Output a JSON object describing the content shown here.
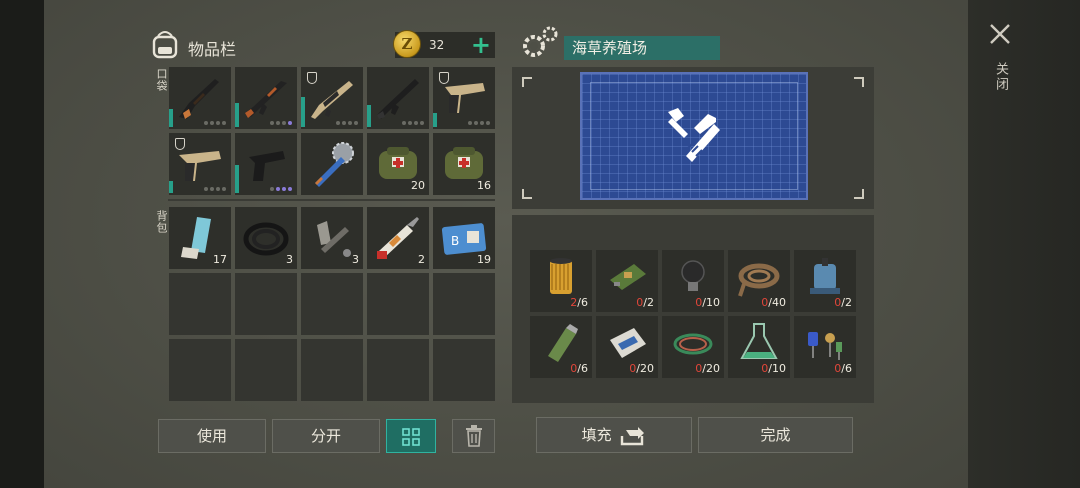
{
  "inventory": {
    "title": "物品栏",
    "coins": "32",
    "coin_symbol": "Z",
    "plus": "+",
    "pocket_label": "口袋",
    "backpack_label": "背包",
    "pocket_slots": [
      {
        "item": "sniper-rifle-icon",
        "count": "",
        "dots": 4
      },
      {
        "item": "assault-rifle-ak-icon",
        "count": "",
        "dots": 4
      },
      {
        "item": "tan-rifle-icon",
        "count": "",
        "dots": 4
      },
      {
        "item": "m4-rifle-icon",
        "count": "",
        "dots": 4
      },
      {
        "item": "tan-pistol-icon",
        "count": "",
        "dots": 4
      },
      {
        "item": "tan-pistol-icon",
        "count": "",
        "dots": 4
      },
      {
        "item": "black-pistol-icon",
        "count": "",
        "dots": 4
      },
      {
        "item": "saw-bat-icon",
        "count": "",
        "dots": 0
      },
      {
        "item": "medkit-bag-icon",
        "count": "20"
      },
      {
        "item": "medkit-bag-icon",
        "count": "16"
      }
    ],
    "backpack_slots": [
      {
        "item": "inhaler-icon",
        "count": "17"
      },
      {
        "item": "hose-coil-icon",
        "count": "3"
      },
      {
        "item": "pipe-parts-icon",
        "count": "3"
      },
      {
        "item": "syringe-icon",
        "count": "2"
      },
      {
        "item": "id-card-icon",
        "count": "19"
      }
    ]
  },
  "buttons": {
    "use": "使用",
    "split": "分开",
    "fill": "填充",
    "complete": "完成"
  },
  "recipe": {
    "title": "海草养殖场",
    "materials": [
      {
        "item": "oil-filter-icon",
        "have": "2",
        "need": "/6"
      },
      {
        "item": "circuit-board-icon",
        "have": "0",
        "need": "/2"
      },
      {
        "item": "light-bulb-icon",
        "have": "0",
        "need": "/10"
      },
      {
        "item": "rope-icon",
        "have": "0",
        "need": "/40"
      },
      {
        "item": "water-pump-icon",
        "have": "0",
        "need": "/2"
      },
      {
        "item": "battery-cell-icon",
        "have": "0",
        "need": "/6"
      },
      {
        "item": "cement-bag-icon",
        "have": "0",
        "need": "/20"
      },
      {
        "item": "wire-coil-icon",
        "have": "0",
        "need": "/20"
      },
      {
        "item": "flask-icon",
        "have": "0",
        "need": "/10"
      },
      {
        "item": "electronic-parts-icon",
        "have": "0",
        "need": "/6"
      }
    ]
  },
  "close": {
    "label": "关闭"
  },
  "colors": {
    "accent": "#2c6f67",
    "missing": "#e0463a",
    "plus": "#33c08f"
  }
}
